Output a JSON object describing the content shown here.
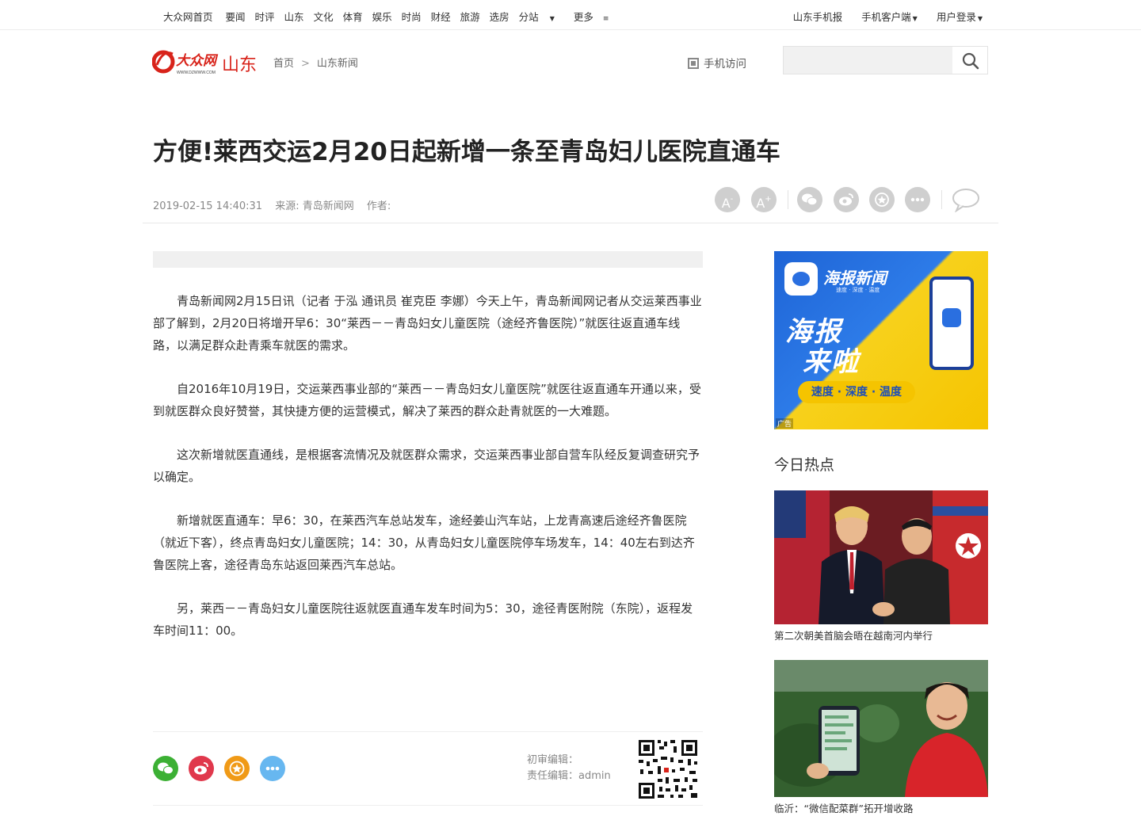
{
  "topbar": {
    "nav": [
      "大众网首页",
      "要闻",
      "时评",
      "山东",
      "文化",
      "体育",
      "娱乐",
      "时尚",
      "财经",
      "旅游",
      "选房",
      "分站",
      "更多"
    ],
    "right": [
      "山东手机报",
      "手机客户端",
      "用户登录"
    ]
  },
  "header": {
    "logo_text": "大众网",
    "logo_url": "WWW.DZWWW.COM",
    "region": "山东",
    "breadcrumb": [
      "首页",
      "山东新闻"
    ],
    "breadcrumb_sep": ">",
    "mobile_visit": "手机访问",
    "search_placeholder": ""
  },
  "article": {
    "title": "方便!莱西交运2月20日起新增一条至青岛妇儿医院直通车",
    "datetime": "2019-02-15 14:40:31",
    "source": "来源: 青岛新闻网",
    "author": "作者:",
    "paragraphs": [
      "青岛新闻网2月15日讯（记者 于泓 通讯员 崔克臣 李娜）今天上午，青岛新闻网记者从交运莱西事业部了解到，2月20日将增开早6：30“莱西－－青岛妇女儿童医院（途经齐鲁医院）”就医往返直通车线路，以满足群众赴青乘车就医的需求。",
      "自2016年10月19日，交运莱西事业部的“莱西－－青岛妇女儿童医院”就医往返直通车开通以来，受到就医群众良好赞誉，其快捷方便的运营模式，解决了莱西的群众赴青就医的一大难题。",
      "这次新增就医直通线，是根据客流情况及就医群众需求，交运莱西事业部自营车队经反复调查研究予以确定。",
      "新增就医直通车：早6：30，在莱西汽车总站发车，途经姜山汽车站，上龙青高速后途经齐鲁医院（就近下客），终点青岛妇女儿童医院；14：30，从青岛妇女儿童医院停车场发车，14：40左右到达齐鲁医院上客，途径青岛东站返回莱西汽车总站。",
      "另，莱西－－青岛妇女儿童医院往返就医直通车发车时间为5：30，途径青医附院（东院），返程发车时间11：00。"
    ],
    "first_editor": "初审编辑：",
    "responsible_editor": "责任编辑：admin"
  },
  "tools": {
    "font_smaller": "A",
    "font_larger": "A",
    "minus": "-",
    "plus": "+"
  },
  "sidebar": {
    "ad": {
      "brand": "海报新闻",
      "brand_sub": "速度 · 深度 · 温度",
      "headline_1": "海报",
      "headline_2": "来啦",
      "slogan": "速度 · 深度 · 温度",
      "label": "广告"
    },
    "hot_title": "今日热点",
    "hot_items": [
      {
        "caption": "第二次朝美首脑会晤在越南河内举行"
      },
      {
        "caption": "临沂：“微信配菜群”拓开增收路"
      }
    ]
  },
  "colors": {
    "brand_red": "#d8231a",
    "wechat": "#3cb034",
    "weibo": "#e0384c",
    "favorite": "#f09a17",
    "more": "#67b7f0",
    "tool_gray": "#cfcfcf"
  }
}
